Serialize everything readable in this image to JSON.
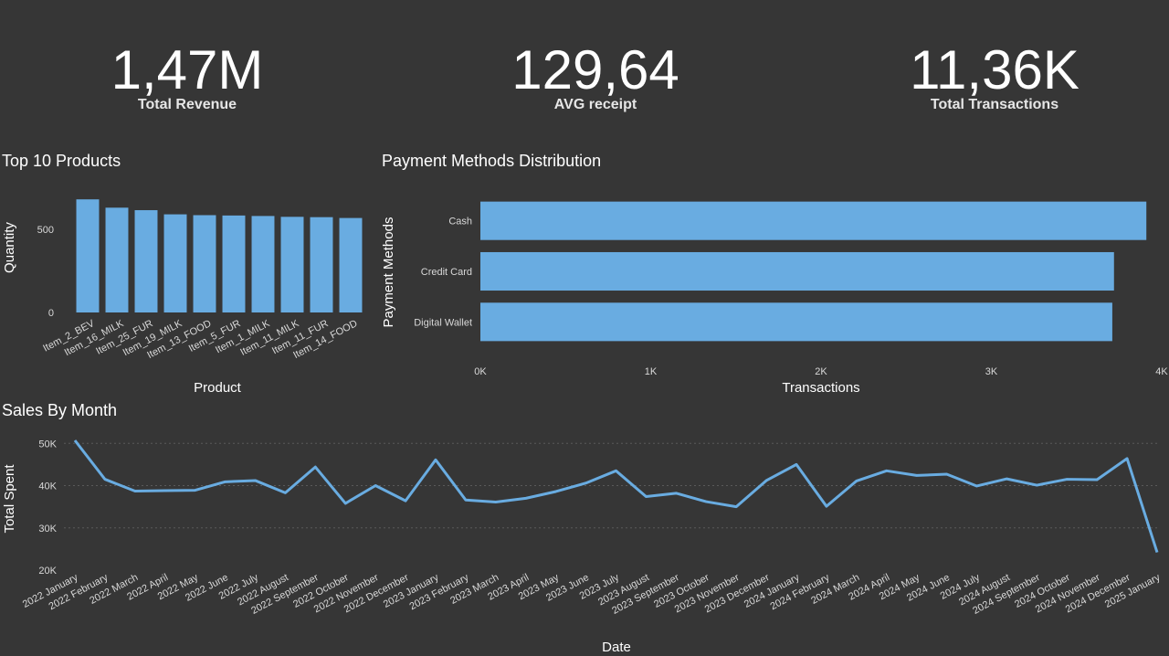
{
  "kpis": {
    "revenue": {
      "value": "1,47M",
      "label": "Total Revenue"
    },
    "avg_receipt": {
      "value": "129,64",
      "label": "AVG receipt"
    },
    "transactions": {
      "value": "11,36K",
      "label": "Total Transactions"
    }
  },
  "colors": {
    "background": "#363636",
    "bar": "#69ace1",
    "line": "#69ace1"
  },
  "chart_data": [
    {
      "type": "bar",
      "title": "Top 10 Products",
      "xlabel": "Product",
      "ylabel": "Quantity",
      "categories": [
        "Item_2_BEV",
        "Item_16_MILK",
        "Item_25_FUR",
        "Item_19_MILK",
        "Item_13_FOOD",
        "Item_5_FUR",
        "Item_1_MILK",
        "Item_11_MILK",
        "Item_11_FUR",
        "Item_14_FOOD"
      ],
      "values": [
        680,
        630,
        615,
        590,
        585,
        583,
        580,
        575,
        573,
        568
      ],
      "ylim": [
        0,
        780
      ],
      "yticks": [
        {
          "v": 0,
          "label": "0"
        },
        {
          "v": 500,
          "label": "500"
        }
      ]
    },
    {
      "type": "bar",
      "orientation": "horizontal",
      "title": "Payment Methods Distribution",
      "xlabel": "Transactions",
      "ylabel": "Payment Methods",
      "categories": [
        "Cash",
        "Credit Card",
        "Digital Wallet"
      ],
      "values": [
        3910,
        3720,
        3710
      ],
      "xlim": [
        0,
        4000
      ],
      "xticks": [
        {
          "v": 0,
          "label": "0K"
        },
        {
          "v": 1000,
          "label": "1K"
        },
        {
          "v": 2000,
          "label": "2K"
        },
        {
          "v": 3000,
          "label": "3K"
        },
        {
          "v": 4000,
          "label": "4K"
        }
      ]
    },
    {
      "type": "line",
      "title": "Sales By Month",
      "xlabel": "Date",
      "ylabel": "Total Spent",
      "categories": [
        "2022 January",
        "2022 February",
        "2022 March",
        "2022 April",
        "2022 May",
        "2022 June",
        "2022 July",
        "2022 August",
        "2022 September",
        "2022 October",
        "2022 November",
        "2022 December",
        "2023 January",
        "2023 February",
        "2023 March",
        "2023 April",
        "2023 May",
        "2023 June",
        "2023 July",
        "2023 August",
        "2023 September",
        "2023 October",
        "2023 November",
        "2023 December",
        "2024 January",
        "2024 February",
        "2024 March",
        "2024 April",
        "2024 May",
        "2024 June",
        "2024 July",
        "2024 August",
        "2024 September",
        "2024 October",
        "2024 November",
        "2024 December",
        "2025 January"
      ],
      "values": [
        50700,
        41500,
        38700,
        38800,
        38900,
        40900,
        41200,
        38300,
        44400,
        35800,
        40000,
        36400,
        46100,
        36600,
        36100,
        37000,
        38600,
        40600,
        43500,
        37400,
        38200,
        36200,
        35000,
        41200,
        45000,
        35100,
        41100,
        43500,
        42400,
        42700,
        39900,
        41600,
        40100,
        41500,
        41400,
        46400,
        24200
      ],
      "ylim": [
        20000,
        52000
      ],
      "yticks": [
        {
          "v": 20000,
          "label": "20K"
        },
        {
          "v": 30000,
          "label": "30K"
        },
        {
          "v": 40000,
          "label": "40K"
        },
        {
          "v": 50000,
          "label": "50K"
        }
      ]
    }
  ]
}
